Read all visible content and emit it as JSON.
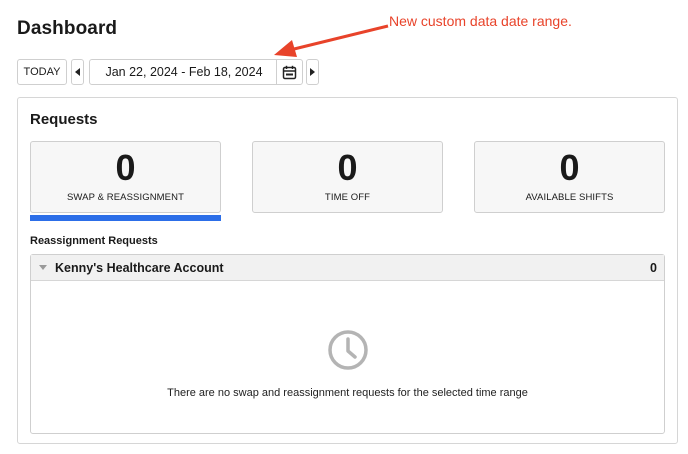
{
  "header": {
    "title": "Dashboard"
  },
  "annotation": {
    "text": "New custom data date range.",
    "color": "#e8432a"
  },
  "toolbar": {
    "today_label": "TODAY",
    "date_range": "Jan 22, 2024 - Feb 18, 2024",
    "icons": {
      "prev": "triangle-left-icon",
      "next": "triangle-right-icon",
      "calendar": "calendar-icon"
    }
  },
  "requests": {
    "title": "Requests",
    "cards": [
      {
        "value": "0",
        "label": "SWAP & REASSIGNMENT",
        "active": true
      },
      {
        "value": "0",
        "label": "TIME OFF",
        "active": false
      },
      {
        "value": "0",
        "label": "AVAILABLE SHIFTS",
        "active": false
      }
    ],
    "active_color": "#2c6ee8",
    "section_label": "Reassignment Requests",
    "groups": [
      {
        "name": "Kenny's Healthcare Account",
        "count": "0",
        "expanded": true
      }
    ],
    "empty_message": "There are no swap and reassignment requests for the selected time range",
    "empty_icon": "clock-icon"
  }
}
